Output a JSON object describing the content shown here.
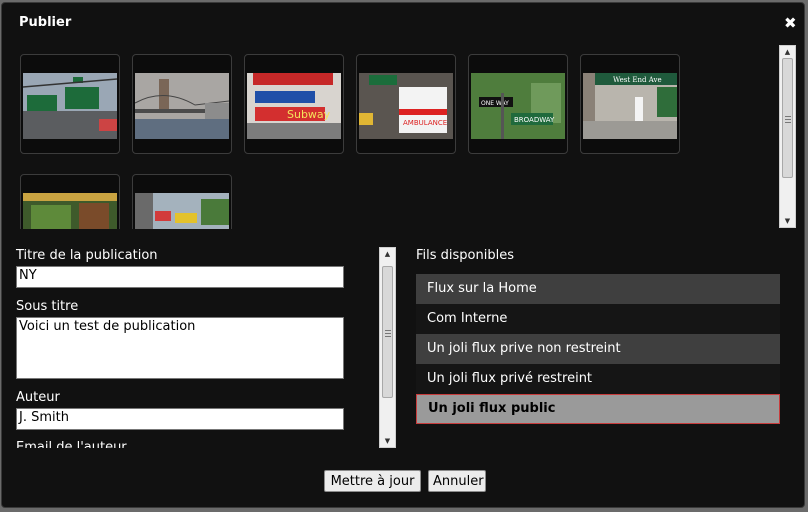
{
  "dialog": {
    "title": "Publier",
    "close_glyph": "✖"
  },
  "form": {
    "title_label": "Titre de la publication",
    "title_value": "NY",
    "subtitle_label": "Sous titre",
    "subtitle_value": "Voici un test de publication",
    "author_label": "Auteur",
    "author_value": "J. Smith",
    "email_label": "Email de l'auteur"
  },
  "feeds": {
    "heading": "Fils disponibles",
    "items": [
      {
        "label": "Flux sur la Home"
      },
      {
        "label": "Com Interne"
      },
      {
        "label": "Un joli flux prive non restreint"
      },
      {
        "label": "Un joli flux privé restreint"
      },
      {
        "label": "Un joli flux public",
        "selected": true
      }
    ]
  },
  "photo_texts": {
    "p3_sign": "Subway",
    "p4_truck": "AMBULANCE",
    "p5_sign1": "ONE WAY",
    "p5_sign2": "BROADWAY",
    "p6_sign": "West End Ave"
  },
  "buttons": {
    "update": "Mettre à jour",
    "cancel": "Annuler"
  },
  "colors": {
    "accent_selected_border": "#c83c3c",
    "dialog_bg": "#111111"
  }
}
